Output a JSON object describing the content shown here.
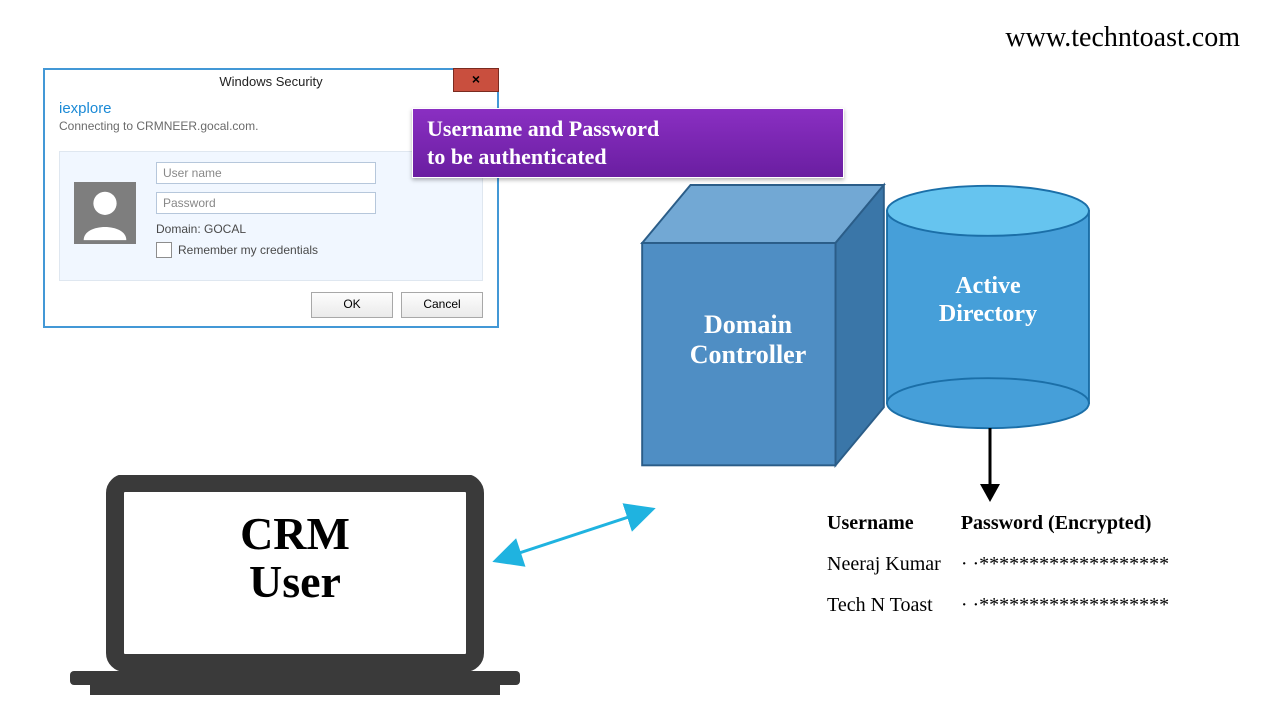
{
  "watermark": "www.techntoast.com",
  "dialog": {
    "title": "Windows Security",
    "close_glyph": "×",
    "app": "iexplore",
    "connecting": "Connecting to CRMNEER.gocal.com.",
    "username_ph": "User name",
    "password_ph": "Password",
    "domain_label": "Domain: GOCAL",
    "remember_label": "Remember my credentials",
    "ok_label": "OK",
    "cancel_label": "Cancel"
  },
  "callout": {
    "line1": "Username and Password",
    "line2": "to be authenticated"
  },
  "cube_label_line1": "Domain",
  "cube_label_line2": "Controller",
  "cylinder_label_line1": "Active",
  "cylinder_label_line2": "Directory",
  "laptop_label_line1": "CRM",
  "laptop_label_line2": "User",
  "table": {
    "col1": "Username",
    "col2": "Password (Encrypted)",
    "rows": [
      {
        "user": "Neeraj Kumar",
        "pwd": "· ·*******************"
      },
      {
        "user": "Tech N Toast",
        "pwd": "· ·*******************"
      }
    ]
  },
  "colors": {
    "dialog_border": "#4398d6",
    "callout_bg": "#7a24b0",
    "cube_front": "#4f8ec4",
    "cube_top": "#72a8d4",
    "cube_side": "#3a76a8",
    "cyl_body": "#469fd9",
    "cyl_top": "#66c4ef",
    "arrow_cyan": "#1fb3e0"
  }
}
